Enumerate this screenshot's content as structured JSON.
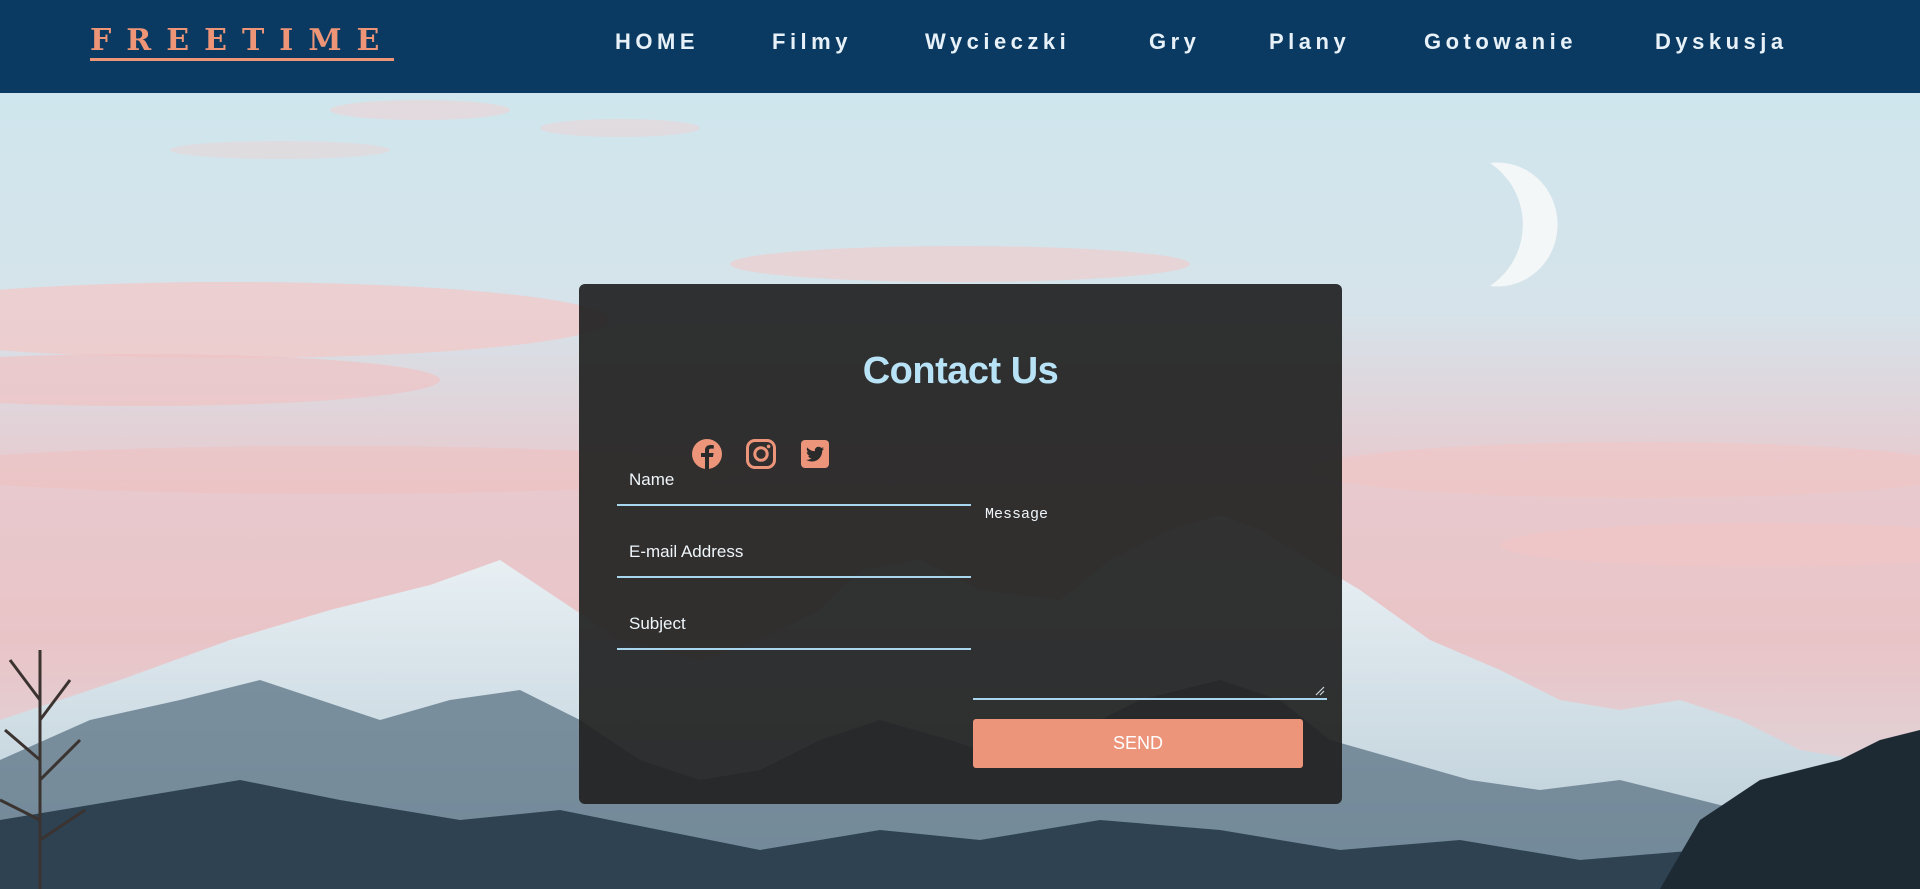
{
  "header": {
    "logo": "FREETIME",
    "nav": [
      {
        "label": "HOME"
      },
      {
        "label": "Filmy"
      },
      {
        "label": "Wycieczki"
      },
      {
        "label": "Gry"
      },
      {
        "label": "Plany"
      },
      {
        "label": "Gotowanie"
      },
      {
        "label": "Dyskusja"
      }
    ]
  },
  "contact": {
    "title": "Contact Us",
    "social": [
      {
        "icon": "facebook-icon"
      },
      {
        "icon": "instagram-icon"
      },
      {
        "icon": "twitter-icon"
      }
    ],
    "fields": {
      "name_placeholder": "Name",
      "email_placeholder": "E-mail Address",
      "subject_placeholder": "Subject",
      "message_placeholder": "Message"
    },
    "send_label": "SEND"
  },
  "colors": {
    "nav_bg": "#0a3a62",
    "accent": "#ec957a",
    "title": "#b8e2f5",
    "card_bg": "#212121"
  }
}
